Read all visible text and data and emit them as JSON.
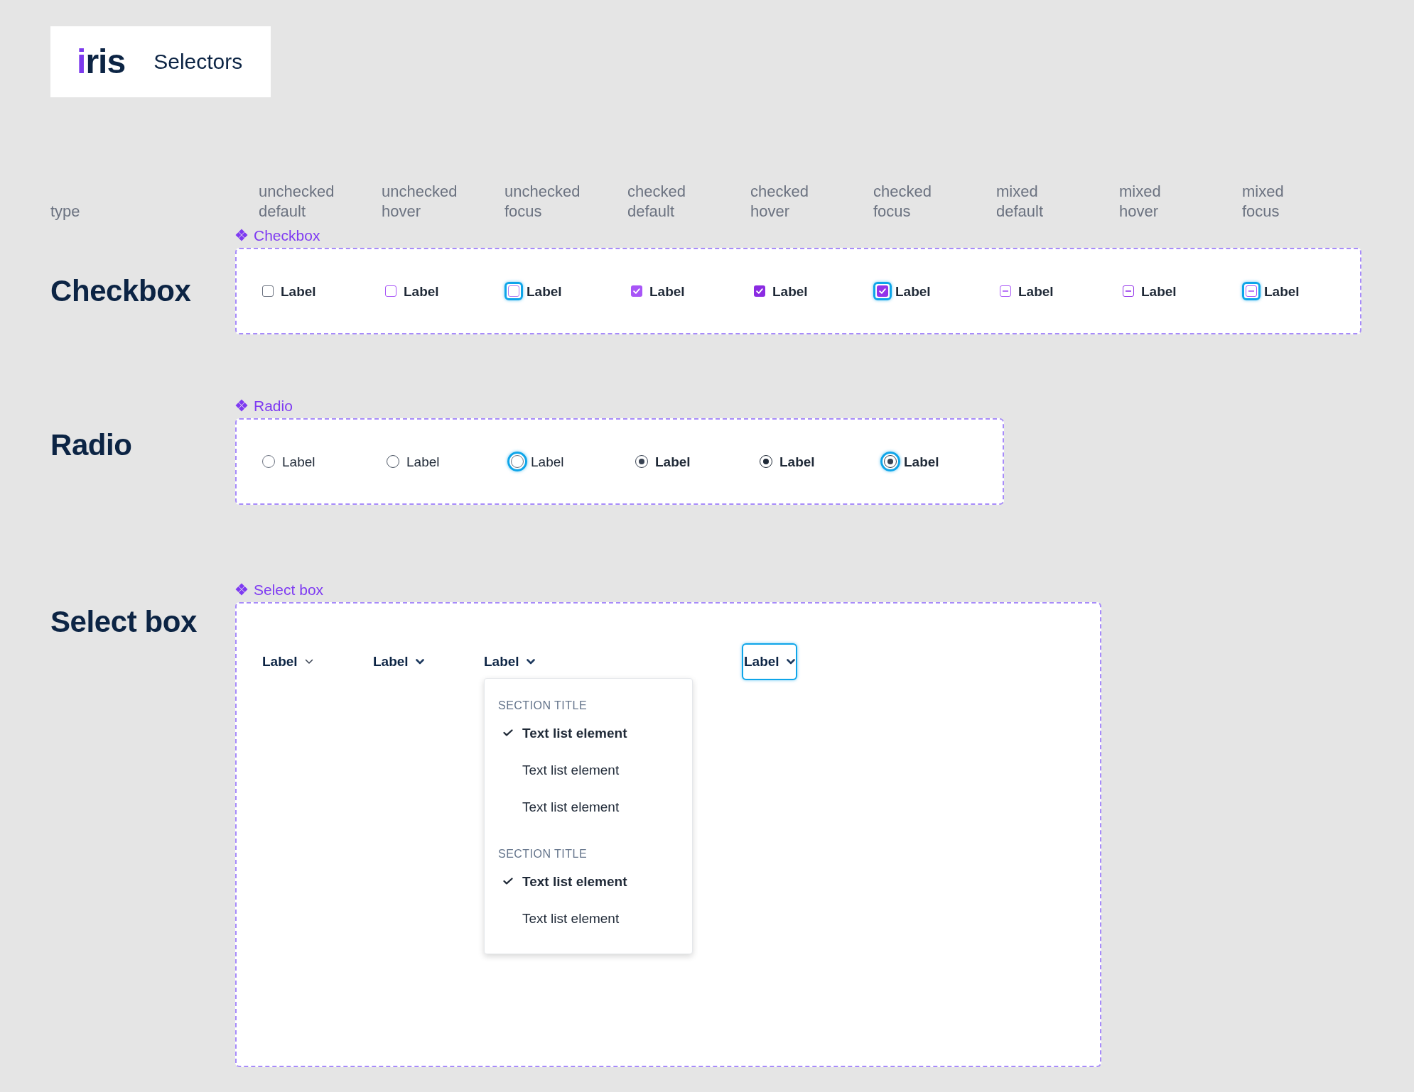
{
  "header": {
    "logo": "iris",
    "title": "Selectors"
  },
  "columns": {
    "type_label": "type",
    "states": [
      "unchecked default",
      "unchecked hover",
      "unchecked focus",
      "checked default",
      "checked hover",
      "checked focus",
      "mixed default",
      "mixed hover",
      "mixed focus"
    ]
  },
  "checkbox": {
    "title": "Checkbox",
    "tag": "Checkbox",
    "items": [
      {
        "label": "Label",
        "kind": "default",
        "checked": false,
        "mixed": false
      },
      {
        "label": "Label",
        "kind": "hover",
        "checked": false,
        "mixed": false
      },
      {
        "label": "Label",
        "kind": "focus",
        "checked": false,
        "mixed": false
      },
      {
        "label": "Label",
        "kind": "default",
        "checked": true,
        "mixed": false
      },
      {
        "label": "Label",
        "kind": "hover",
        "checked": true,
        "mixed": false
      },
      {
        "label": "Label",
        "kind": "focus",
        "checked": true,
        "mixed": false
      },
      {
        "label": "Label",
        "kind": "default",
        "checked": false,
        "mixed": true
      },
      {
        "label": "Label",
        "kind": "hover",
        "checked": false,
        "mixed": true
      },
      {
        "label": "Label",
        "kind": "focus",
        "checked": false,
        "mixed": true
      }
    ]
  },
  "radio": {
    "title": "Radio",
    "tag": "Radio",
    "items": [
      {
        "label": "Label",
        "kind": "default",
        "selected": false
      },
      {
        "label": "Label",
        "kind": "hover",
        "selected": false
      },
      {
        "label": "Label",
        "kind": "focus",
        "selected": false
      },
      {
        "label": "Label",
        "kind": "default",
        "selected": true
      },
      {
        "label": "Label",
        "kind": "hover",
        "selected": true
      },
      {
        "label": "Label",
        "kind": "focus",
        "selected": true
      }
    ]
  },
  "select_box": {
    "title": "Select box",
    "tag": "Select box",
    "items": [
      {
        "label": "Label",
        "kind": "default"
      },
      {
        "label": "Label",
        "kind": "hover"
      },
      {
        "label": "Label",
        "kind": "open",
        "menu": [
          {
            "title": "SECTION TITLE",
            "items": [
              {
                "label": "Text list element",
                "selected": true
              },
              {
                "label": "Text list element",
                "selected": false
              },
              {
                "label": "Text list element",
                "selected": false
              }
            ]
          },
          {
            "title": "SECTION TITLE",
            "items": [
              {
                "label": "Text list element",
                "selected": true
              },
              {
                "label": "Text list element",
                "selected": false
              }
            ]
          }
        ]
      },
      {
        "label": "Label",
        "kind": "focus"
      }
    ]
  }
}
